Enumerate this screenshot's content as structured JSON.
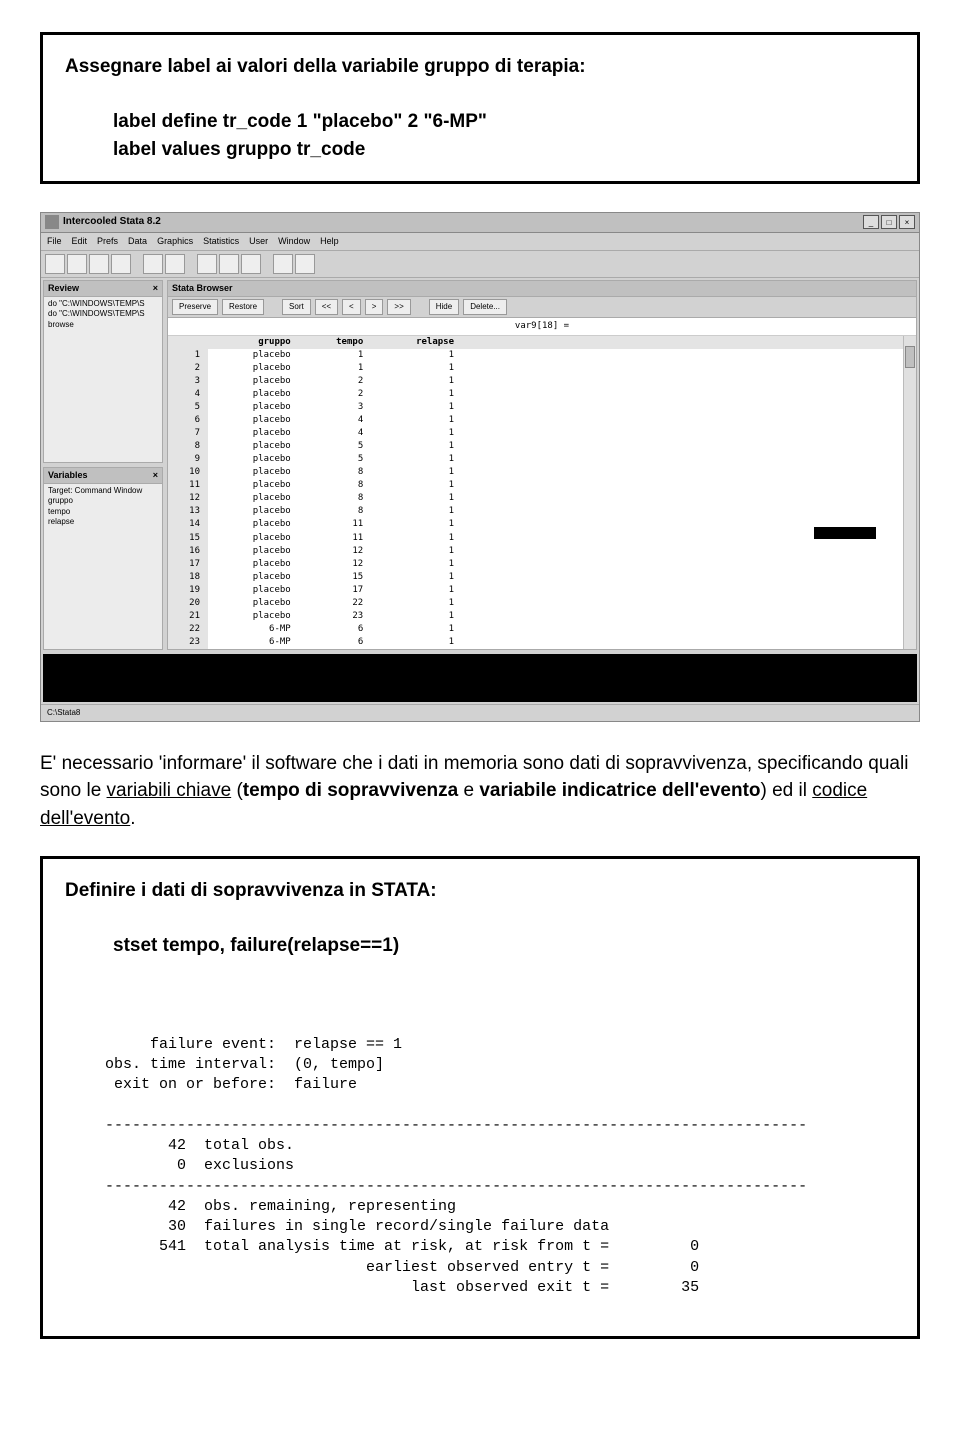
{
  "box1": {
    "title": "Assegnare label ai valori della variabile gruppo di terapia:",
    "cmd1": "label define tr_code 1 \"placebo\" 2 \"6-MP\"",
    "cmd2": "label values gruppo tr_code"
  },
  "stata": {
    "app_title": "Intercooled Stata 8.2",
    "menu": [
      "File",
      "Edit",
      "Prefs",
      "Data",
      "Graphics",
      "Statistics",
      "User",
      "Window",
      "Help"
    ],
    "review_title": "Review",
    "review_items": [
      "do \"C:\\WINDOWS\\TEMP\\S",
      "do \"C:\\WINDOWS\\TEMP\\S",
      "browse"
    ],
    "variables_title": "Variables",
    "variables_header": "Target: Command Window",
    "variables_items": [
      "gruppo",
      "tempo",
      "relapse"
    ],
    "browser_title": "Stata Browser",
    "browser_buttons": [
      "Preserve",
      "Restore",
      "Sort",
      "<<",
      "<",
      ">",
      ">>",
      "Hide",
      "Delete..."
    ],
    "var_field": "var9[18] =",
    "columns": [
      "gruppo",
      "tempo",
      "relapse"
    ],
    "rows": [
      [
        1,
        "placebo",
        1,
        1
      ],
      [
        2,
        "placebo",
        1,
        1
      ],
      [
        3,
        "placebo",
        2,
        1
      ],
      [
        4,
        "placebo",
        2,
        1
      ],
      [
        5,
        "placebo",
        3,
        1
      ],
      [
        6,
        "placebo",
        4,
        1
      ],
      [
        7,
        "placebo",
        4,
        1
      ],
      [
        8,
        "placebo",
        5,
        1
      ],
      [
        9,
        "placebo",
        5,
        1
      ],
      [
        10,
        "placebo",
        8,
        1
      ],
      [
        11,
        "placebo",
        8,
        1
      ],
      [
        12,
        "placebo",
        8,
        1
      ],
      [
        13,
        "placebo",
        8,
        1
      ],
      [
        14,
        "placebo",
        11,
        1
      ],
      [
        15,
        "placebo",
        11,
        1
      ],
      [
        16,
        "placebo",
        12,
        1
      ],
      [
        17,
        "placebo",
        12,
        1
      ],
      [
        18,
        "placebo",
        15,
        1
      ],
      [
        19,
        "placebo",
        17,
        1
      ],
      [
        20,
        "placebo",
        22,
        1
      ],
      [
        21,
        "placebo",
        23,
        1
      ],
      [
        22,
        "6-MP",
        6,
        1
      ],
      [
        23,
        "6-MP",
        6,
        1
      ]
    ],
    "statusbar": "C:\\Stata8"
  },
  "para1_pre": "E' necessario 'informare' il software che i dati in memoria sono dati di sopravvivenza, specificando quali sono le ",
  "para1_u1": "variabili chiave",
  "para1_mid1": " (",
  "para1_b1": "tempo di sopravvivenza",
  "para1_mid2": " e ",
  "para1_b2": "variabile indicatrice dell'evento",
  "para1_mid3": ") ed il ",
  "para1_u2": "codice dell'evento",
  "para1_end": ".",
  "box2": {
    "title": "Definire i dati di sopravvivenza in STATA:",
    "cmd": "stset tempo, failure(relapse==1)",
    "out": "     failure event:  relapse == 1\nobs. time interval:  (0, tempo]\n exit on or before:  failure\n\n------------------------------------------------------------------------------\n       42  total obs.\n        0  exclusions\n------------------------------------------------------------------------------\n       42  obs. remaining, representing\n       30  failures in single record/single failure data\n      541  total analysis time at risk, at risk from t =         0\n                             earliest observed entry t =         0\n                                  last observed exit t =        35"
  }
}
